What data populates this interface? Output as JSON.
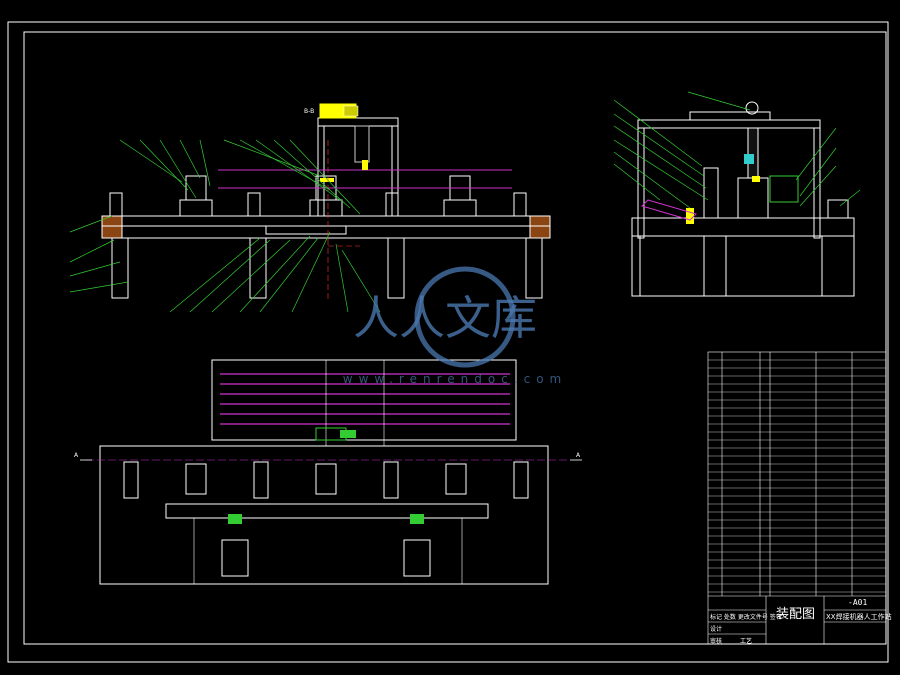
{
  "colors": {
    "background": "#000000",
    "line_white": "#ffffff",
    "line_green": "#33cc33",
    "line_magenta": "#cc33cc",
    "line_yellow": "#ffff00",
    "line_cyan": "#33cccc",
    "line_red": "#ff3333",
    "watermark_blue": "#4a78b0"
  },
  "watermark": {
    "logo_glyph": "人人文库",
    "url": "www.renrendoc.com"
  },
  "title_block": {
    "drawing_title": "装配图",
    "drawing_code": "-A01",
    "part_name": "XX焊接机器人工作站",
    "sign_row_1": "标记 处数 更改文件号 签名",
    "sign_row_2": "设计",
    "sign_row_3": "审核",
    "sign_row_4": "工艺"
  },
  "view_labels": {
    "section_marker_left": "A",
    "section_marker_right": "A",
    "top_label": "B-B"
  }
}
